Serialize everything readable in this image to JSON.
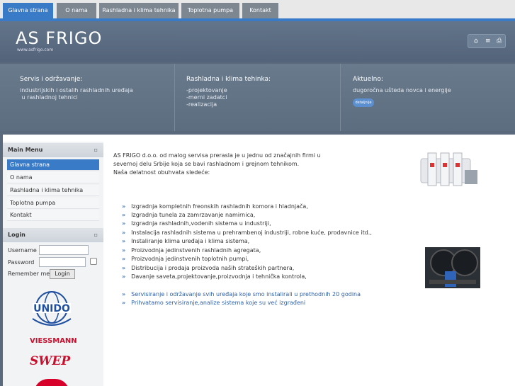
{
  "nav": {
    "tabs": [
      {
        "label": "Glavna strana"
      },
      {
        "label": "O nama"
      },
      {
        "label": "Rashladna i klima tehnika"
      },
      {
        "label": "Toplotna pumpa"
      },
      {
        "label": "Kontakt"
      }
    ],
    "active_tab": "Glavna strana"
  },
  "header": {
    "logo": "AS FRIGO",
    "url": "www.asfrigo.com",
    "icons": [
      "home-icon",
      "email-icon",
      "print-icon"
    ]
  },
  "info": {
    "servis": {
      "title": "Servis i održavanje:",
      "text": "industrijskih i ostalih rashladnih uređaja\n u rashladnoj tehnici"
    },
    "rashladna": {
      "title": "Rashladna i klima tehinka:",
      "text": "-projektovanje\n-merni zadatci\n-realizacija"
    },
    "aktuelno": {
      "title": "Aktuelno:",
      "text": "dugoročna ušteda novca i energije",
      "button": "detaljnije"
    }
  },
  "sidebar": {
    "main_menu_title": "Main Menu",
    "menu": [
      {
        "label": "Glavna strana"
      },
      {
        "label": "O nama"
      },
      {
        "label": "Rashladna i klima tehnika"
      },
      {
        "label": "Toplotna pumpa"
      },
      {
        "label": "Kontakt"
      }
    ],
    "login_title": "Login",
    "username_label": "Username",
    "password_label": "Password",
    "remember_label": "Remember me",
    "login_button": "Login",
    "logos": {
      "unido": "UNIDO",
      "viessmann": "VIESSMANN",
      "swep": "SWEP"
    }
  },
  "content": {
    "intro": [
      "AS FRIGO d.o.o. od malog servisa prerasla je u jednu od značajnih firmi u",
      "severnoj delu Srbije koja se bavi rashladnom i grejnom tehnikom.",
      "Naša delatnost obuhvata sledeće:"
    ],
    "bullets": [
      "Izgradnja kompletnih freonskih rashladnih komora i hladnjača,",
      "Izgradnja tunela za zamrzavanje namirnica,",
      "Izgradnja rashladnih,vodenih sistema u industriji,",
      "Instalacija rashladnih sistema u prehrambenoj industriji, robne kuće, prodavnice itd.,",
      "Instaliranje klima uređaja i klima sistema,",
      "Proizvodnja jedinstvenih rashladnih agregata,",
      "Proizvodnja jedinstvenih toplotnih pumpi,",
      "Distribucija i prodaja proizvoda naših strateških partnera,",
      "Davanje saveta,projektovanje,proizvodnja i tehnička kontrola,"
    ],
    "bullets2": [
      "Servisiranje i održavanje svih uređaja koje smo instalirali u prethodnih 20 godina",
      "Prihvatamo servisiranje,analize sistema koje su već izgrađeni"
    ]
  },
  "colors": {
    "accent": "#3a7bc8",
    "header": "#5a6a7c"
  }
}
